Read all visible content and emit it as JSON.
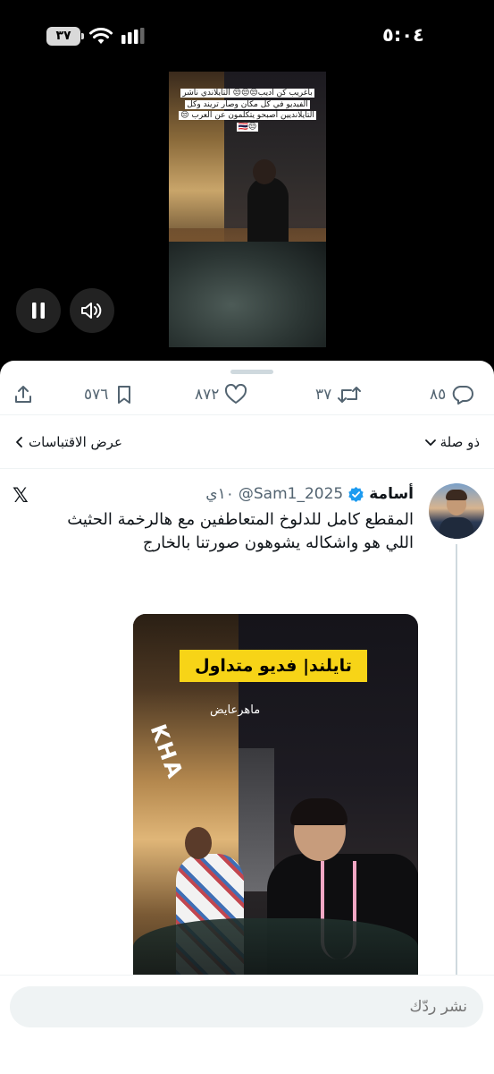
{
  "status_bar": {
    "time": "٥:٠٤",
    "battery": "٣٧"
  },
  "video": {
    "caption": "باغريب كن اديب😒😒😒 التايلاندي ناشر الفيديو في كل مكان وصار تريند وكل التايلانديين أصبحو يتكلمون عن العرب 😒😒🇹🇭"
  },
  "actions": {
    "replies": "٨٥",
    "retweets": "٣٧",
    "likes": "٨٧٢",
    "bookmarks": "٥٧٦"
  },
  "quote_row": {
    "related": "ذو صلة",
    "view_quotes": "عرض الاقتباسات"
  },
  "tweet": {
    "author_name": "أسامة",
    "handle": "@Sam1_2025",
    "time": "١٠ي",
    "text_line1": "المقطع كامل للدلوخ المتعاطفين مع هالرخمة الحثيث",
    "text_line2": "اللي هو واشكاله يشوهون صورتنا بالخارج",
    "media": {
      "banner": "تايلند| فديو متداول",
      "credit": "ماهرعايض",
      "sign": "KHA"
    }
  },
  "reply": {
    "placeholder": "نشر ردّك"
  },
  "colors": {
    "accent": "#1d9bf0",
    "text_secondary": "#536471",
    "banner_yellow": "#f7d417"
  }
}
